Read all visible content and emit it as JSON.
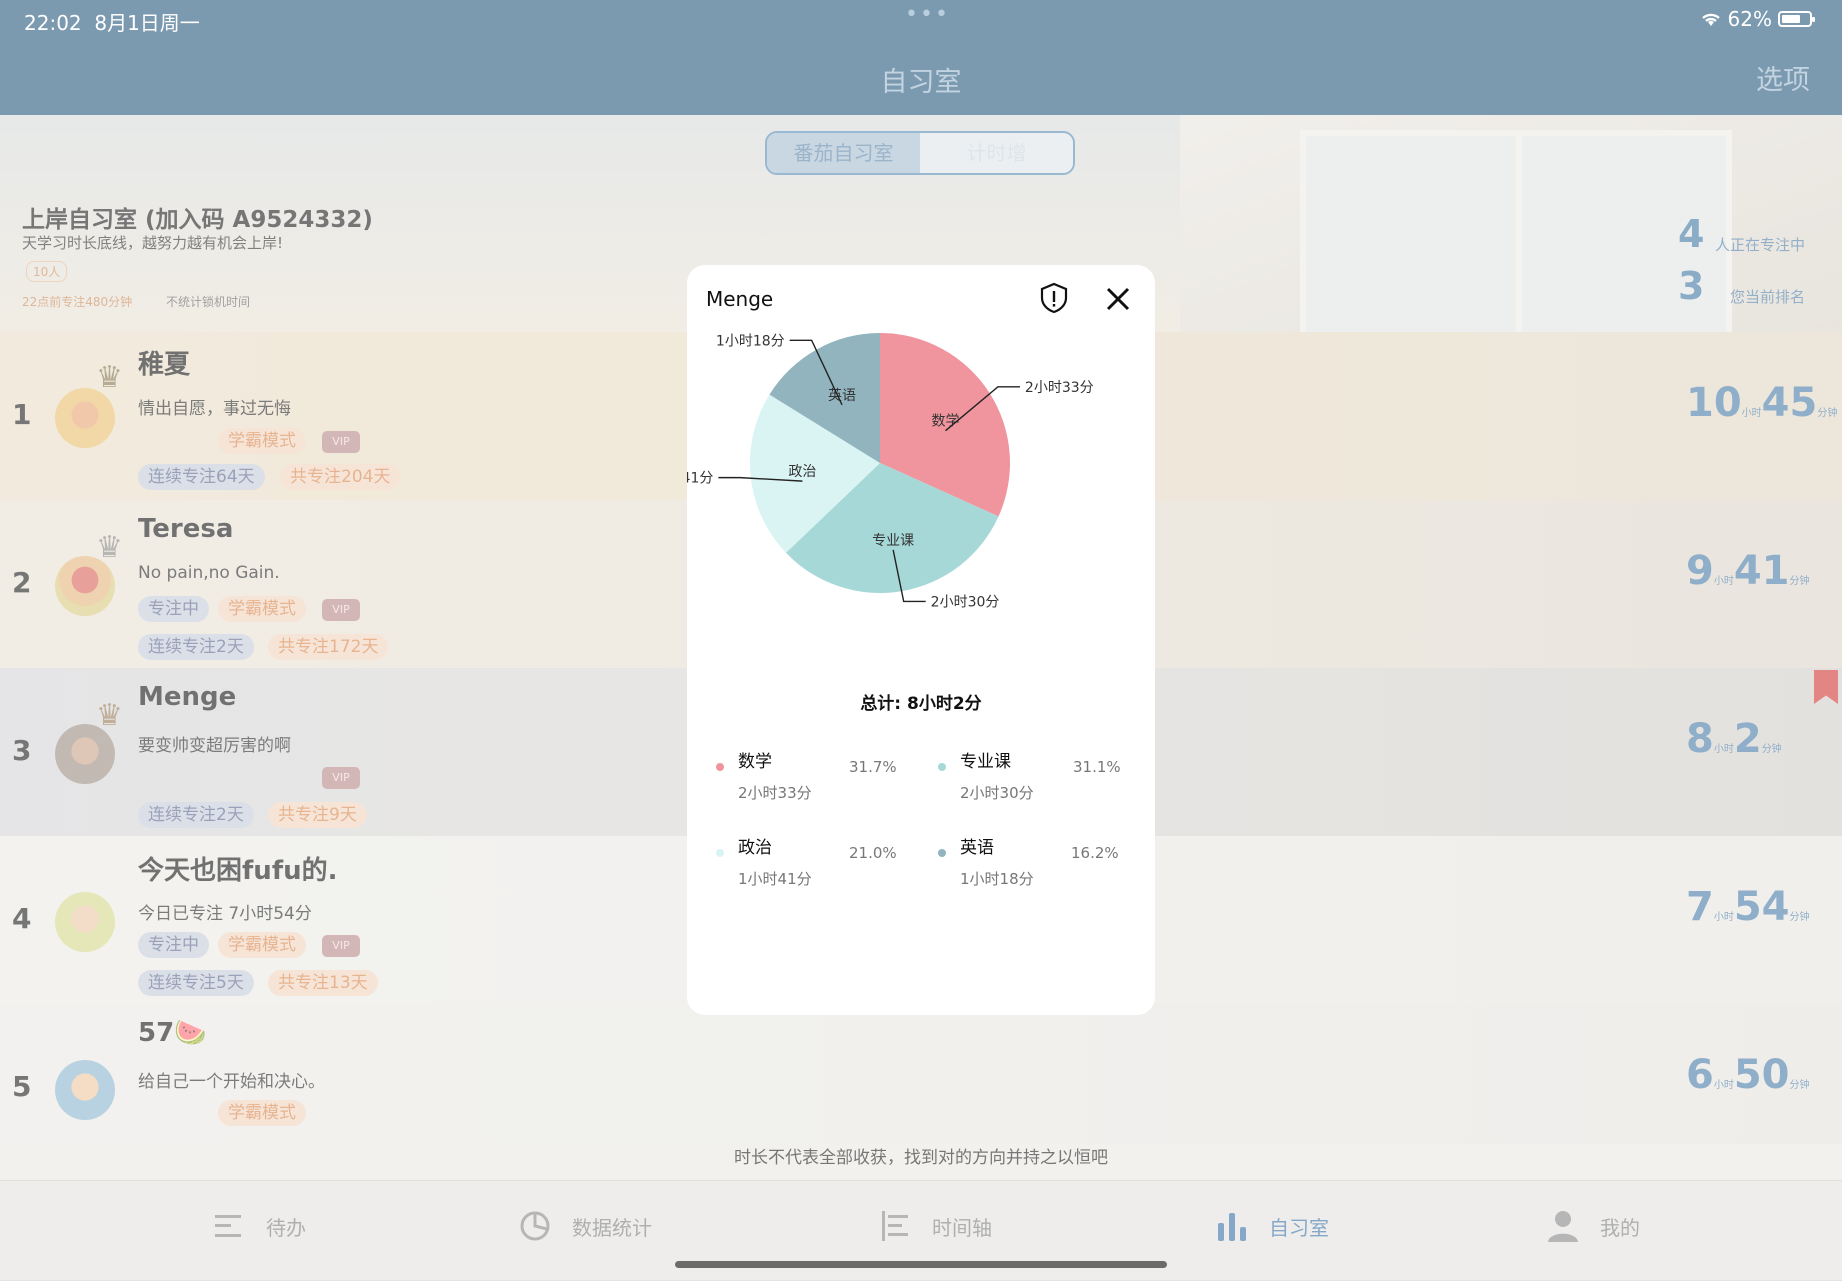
{
  "status_bar": {
    "time": "22:02",
    "date": "8月1日周一",
    "battery": "62%"
  },
  "header": {
    "title": "自习室",
    "options": "选项"
  },
  "segment": {
    "tab1": "番茄自习室",
    "tab2": "计时增"
  },
  "room": {
    "name": "上岸自习室 (加入码 A9524332)",
    "desc": "天学习时长底线，越努力越有机会上岸!",
    "people": "10人",
    "rule": "22点前专注480分钟",
    "lock_note": "不统计锁机时间",
    "focusing_count": "4",
    "focusing_label": "人正在专注中",
    "my_rank": "3",
    "my_rank_label": "您当前排名"
  },
  "rows": [
    {
      "rank": "1",
      "name": "稚夏",
      "motto": "情出自愿，事过无悔",
      "mode": "学霸模式",
      "vip": "VIP",
      "streak": "连续专注64天",
      "total": "共专注204天",
      "hours": "10",
      "minutes": "45",
      "h_unit": "小时",
      "m_unit": "分钟"
    },
    {
      "rank": "2",
      "name": "Teresa",
      "motto": "No pain,no Gain.",
      "status": "专注中",
      "mode": "学霸模式",
      "vip": "VIP",
      "streak": "连续专注2天",
      "total": "共专注172天",
      "hours": "9",
      "minutes": "41",
      "h_unit": "小时",
      "m_unit": "分钟"
    },
    {
      "rank": "3",
      "name": "Menge",
      "motto": "要变帅变超厉害的啊",
      "vip": "VIP",
      "streak": "连续专注2天",
      "total": "共专注9天",
      "hours": "8",
      "minutes": "2",
      "h_unit": "小时",
      "m_unit": "分钟"
    },
    {
      "rank": "4",
      "name": "今天也困fufu的.",
      "motto": "今日已专注 7小时54分",
      "status": "专注中",
      "mode": "学霸模式",
      "vip": "VIP",
      "streak": "连续专注5天",
      "total": "共专注13天",
      "hours": "7",
      "minutes": "54",
      "h_unit": "小时",
      "m_unit": "分钟"
    },
    {
      "rank": "5",
      "name": "57🍉",
      "motto": "给自己一个开始和决心。",
      "mode": "学霸模式",
      "hours": "6",
      "minutes": "50",
      "h_unit": "小时",
      "m_unit": "分钟"
    }
  ],
  "footer_line": "时长不代表全部收获，找到对的方向并持之以恒吧",
  "tabs": [
    {
      "label": "待办",
      "icon": "list-icon"
    },
    {
      "label": "数据统计",
      "icon": "pie-chart-icon"
    },
    {
      "label": "时间轴",
      "icon": "timeline-icon"
    },
    {
      "label": "自习室",
      "icon": "bar-chart-icon",
      "active": true
    },
    {
      "label": "我的",
      "icon": "person-icon"
    }
  ],
  "modal": {
    "title": "Menge",
    "total": "总计: 8小时2分",
    "legend": [
      {
        "name": "数学",
        "time": "2小时33分",
        "pct": "31.7%",
        "color": "#f0959e"
      },
      {
        "name": "专业课",
        "time": "2小时30分",
        "pct": "31.1%",
        "color": "#a6d8d8"
      },
      {
        "name": "政治",
        "time": "1小时41分",
        "pct": "21.0%",
        "color": "#daf4f3"
      },
      {
        "name": "英语",
        "time": "1小时18分",
        "pct": "16.2%",
        "color": "#92b4bf"
      }
    ]
  },
  "chart_data": {
    "type": "pie",
    "title": "",
    "categories": [
      "数学",
      "专业课",
      "政治",
      "英语"
    ],
    "values": [
      153,
      150,
      101,
      78
    ],
    "value_labels": [
      "2小时33分",
      "2小时30分",
      "1小时41分",
      "1小时18分"
    ],
    "percentages": [
      31.7,
      31.1,
      21.0,
      16.2
    ],
    "colors": [
      "#f0959e",
      "#a6d8d8",
      "#daf4f3",
      "#92b4bf"
    ]
  }
}
